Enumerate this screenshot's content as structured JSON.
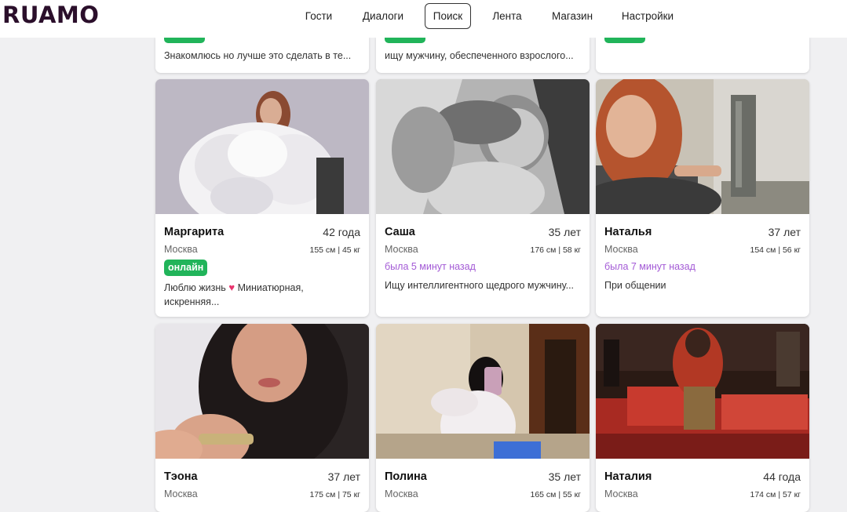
{
  "app": {
    "logo": "RUAMO"
  },
  "nav": [
    {
      "label": "Гости"
    },
    {
      "label": "Диалоги"
    },
    {
      "label": "Поиск"
    },
    {
      "label": "Лента"
    },
    {
      "label": "Магазин"
    },
    {
      "label": "Настройки"
    }
  ],
  "top_row": [
    {
      "about": "Знакомлюсь но лучше это сделать в те..."
    },
    {
      "about": "ищу мужчину, обеспеченного взрослого..."
    },
    {
      "about": ""
    }
  ],
  "profiles": [
    {
      "name": "Маргарита",
      "age": "42 года",
      "city": "Москва",
      "params": "155 см | 45 кг",
      "status": "онлайн",
      "about": "Люблю жизнь",
      "about2": " Миниатюрная,",
      "about3": "искренняя..."
    },
    {
      "name": "Саша",
      "age": "35 лет",
      "city": "Москва",
      "params": "176 см | 58 кг",
      "status": "была 5 минут назад",
      "about": "Ищу интеллигентного щедрого мужчину..."
    },
    {
      "name": "Наталья",
      "age": "37 лет",
      "city": "Москва",
      "params": "154 см | 56 кг",
      "status": "была 7 минут назад",
      "about": "При общении"
    },
    {
      "name": "Тэона",
      "age": "37 лет",
      "city": "Москва",
      "params": "175 см | 75 кг"
    },
    {
      "name": "Полина",
      "age": "35 лет",
      "city": "Москва",
      "params": "165 см | 55 кг"
    },
    {
      "name": "Наталия",
      "age": "44 года",
      "city": "Москва",
      "params": "174 см | 57 кг"
    }
  ],
  "colors": {
    "online": "#21b45a",
    "last_seen": "#a35ad6",
    "logo": "#2b0f2b"
  }
}
